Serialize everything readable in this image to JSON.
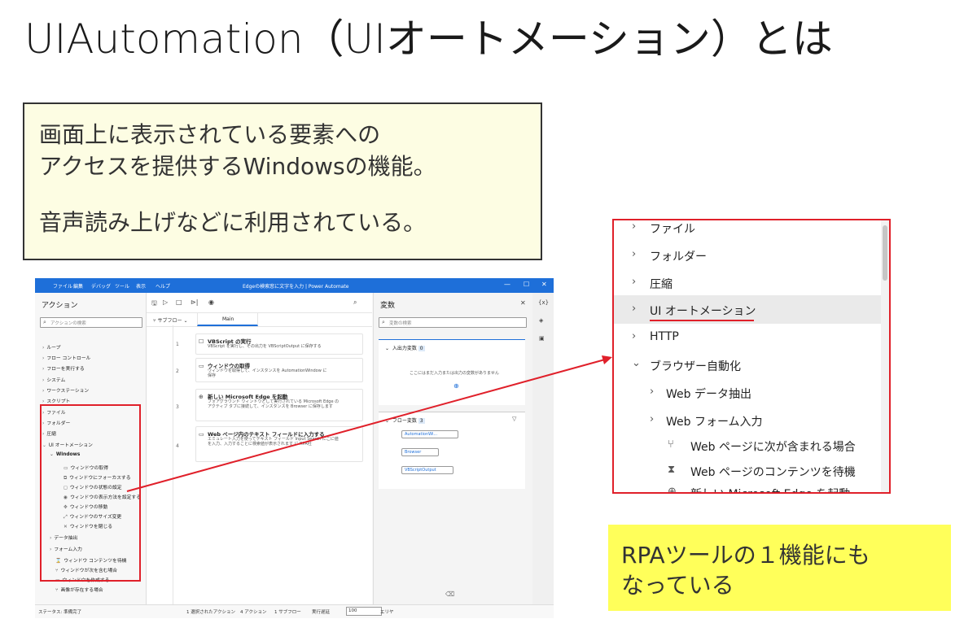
{
  "slide": {
    "title": "UIAutomation（UIオートメーション）とは",
    "description": {
      "line1": "画面上に表示されている要素への",
      "line2": "アクセスを提供するWindowsの機能。",
      "line3": "音声読み上げなどに利用されている。"
    },
    "note": {
      "line1": "RPAツールの１機能にも",
      "line2": "なっている"
    }
  },
  "app": {
    "menu": [
      "ファイル",
      "編集",
      "デバッグ",
      "ツール",
      "表示",
      "ヘルプ"
    ],
    "window_title": "Edgeの検索窓に文字を入力 | Power Automate",
    "window_controls": [
      "—",
      "☐",
      "✕"
    ],
    "actions_pane": {
      "title": "アクション",
      "search_placeholder": "アクションの検索",
      "items": [
        "ループ",
        "フロー コントロール",
        "フローを実行する",
        "システム",
        "ワークステーション",
        "スクリプト",
        "ファイル",
        "フォルダー",
        "圧縮",
        "UI オートメーション"
      ],
      "windows_group": "Windows",
      "windows_items": [
        "ウィンドウの取得",
        "ウィンドウにフォーカスする",
        "ウィンドウの状態の設定",
        "ウィンドウの表示方法を設定する",
        "ウィンドウの移動",
        "ウィンドウのサイズ変更",
        "ウィンドウを閉じる"
      ],
      "more_items": [
        "データ抽出",
        "フォーム入力",
        "ウィンドウ コンテンツを待機",
        "ウィンドウが次を含む場合",
        "ウィンドウを作成する",
        "画像が存在する場合"
      ]
    },
    "flow_pane": {
      "subflow_label": "サブフロー",
      "tab_main": "Main",
      "steps": [
        {
          "num": "1",
          "title": "VBScript の実行",
          "desc1": "VBScript を実行し、その出力を VBScriptOutput に保存する",
          "desc2": ""
        },
        {
          "num": "2",
          "title": "ウィンドウの取得",
          "desc1": "ウィンドウを取得して、インスタンスを AutomationWindow に",
          "desc2": "保存"
        },
        {
          "num": "3",
          "title": "新しい Microsoft Edge を起動",
          "desc1": "フォアグラウンド ウィンドウとして実行されている Microsoft Edge の",
          "desc2": "アクティブ タブに接続して、インスタンスを Browser に保存します"
        },
        {
          "num": "4",
          "title": "Web ページ内のテキスト フィールドに入力する",
          "desc1": "エミュレート入力を使ってテキスト フィールド Input Search にこに値",
          "desc2": "を入力、入力することに検索値が表示されます に RPA社"
        }
      ]
    },
    "vars_pane": {
      "title": "変数",
      "search_placeholder": "変数の検索",
      "io_label": "入出力変数",
      "io_count": "0",
      "io_empty": "ここにはまだ入力または出力の変数がありません",
      "flow_label": "フロー変数",
      "flow_count": "3",
      "flow_vars": [
        "AutomationWi...",
        "Browser",
        "VBScriptOutput"
      ]
    },
    "status": {
      "state": "ステータス: 準備完了",
      "selected": "1 選択されたアクション",
      "actions": "4 アクション",
      "subflows": "1 サブフロー",
      "delay_label": "実行遅延",
      "delay_value": "100",
      "link": "エリヤ"
    }
  },
  "zoom": {
    "items": [
      "ファイル",
      "フォルダー",
      "圧縮",
      "UI オートメーション",
      "HTTP",
      "ブラウザー自動化",
      "Web データ抽出",
      "Web フォーム入力",
      "Web ページに次が含まれる場合",
      "Web ページのコンテンツを待機",
      "新しい Microsoft Edge を起動"
    ]
  }
}
